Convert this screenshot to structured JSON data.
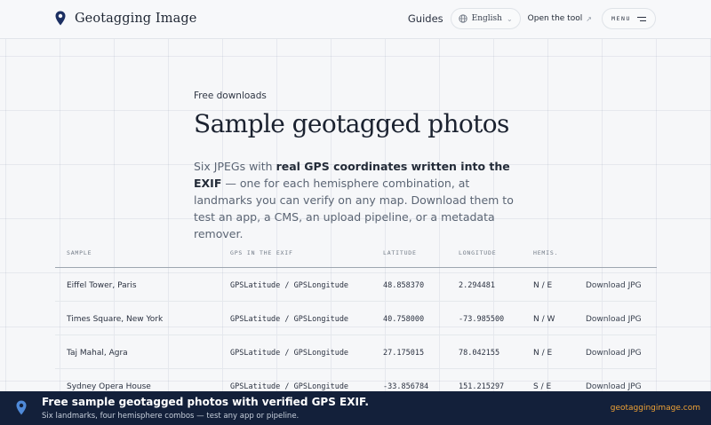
{
  "header": {
    "logo_text": "Geotagging Image",
    "nav": {
      "guides": "Guides",
      "language": "English",
      "open_tool": "Open the tool",
      "menu": "MENU"
    }
  },
  "hero": {
    "eyebrow": "Free downloads",
    "title": "Sample geotagged photos",
    "lede_pre": "Six JPEGs with ",
    "lede_bold": "real GPS coordinates written into the EXIF",
    "lede_post": " — one for each hemisphere combination, at landmarks you can verify on any map. Download them to test an app, a CMS, an upload pipeline, or a metadata remover."
  },
  "table": {
    "columns": [
      "SAMPLE",
      "GPS IN THE EXIF",
      "LATITUDE",
      "LONGITUDE",
      "HEMIS."
    ],
    "rows": [
      {
        "sample": "Eiffel Tower, Paris",
        "gps": "GPSLatitude / GPSLongitude",
        "lat": "48.858370",
        "lon": "2.294481",
        "hemis": "N / E",
        "download": "Download JPG"
      },
      {
        "sample": "Times Square, New York",
        "gps": "GPSLatitude / GPSLongitude",
        "lat": "40.758000",
        "lon": "-73.985500",
        "hemis": "N / W",
        "download": "Download JPG"
      },
      {
        "sample": "Taj Mahal, Agra",
        "gps": "GPSLatitude / GPSLongitude",
        "lat": "27.175015",
        "lon": "78.042155",
        "hemis": "N / E",
        "download": "Download JPG"
      },
      {
        "sample": "Sydney Opera House",
        "gps": "GPSLatitude / GPSLongitude",
        "lat": "-33.856784",
        "lon": "151.215297",
        "hemis": "S / E",
        "download": "Download JPG"
      }
    ]
  },
  "banner": {
    "title": "Free sample geotagged photos with verified GPS EXIF.",
    "subtitle": "Six landmarks, four hemisphere combos — test any app or pipeline.",
    "link": "geotaggingimage.com"
  },
  "colors": {
    "brand_navy": "#13203a",
    "accent_orange": "#f0a235",
    "background": "#f6f7f9"
  },
  "icons": {
    "logo": "map-pin-icon",
    "language": "globe-icon",
    "language_toggle": "chevron-down-icon",
    "open_tool": "arrow-up-right-icon",
    "menu": "hamburger-icon",
    "banner": "map-pin-icon"
  }
}
